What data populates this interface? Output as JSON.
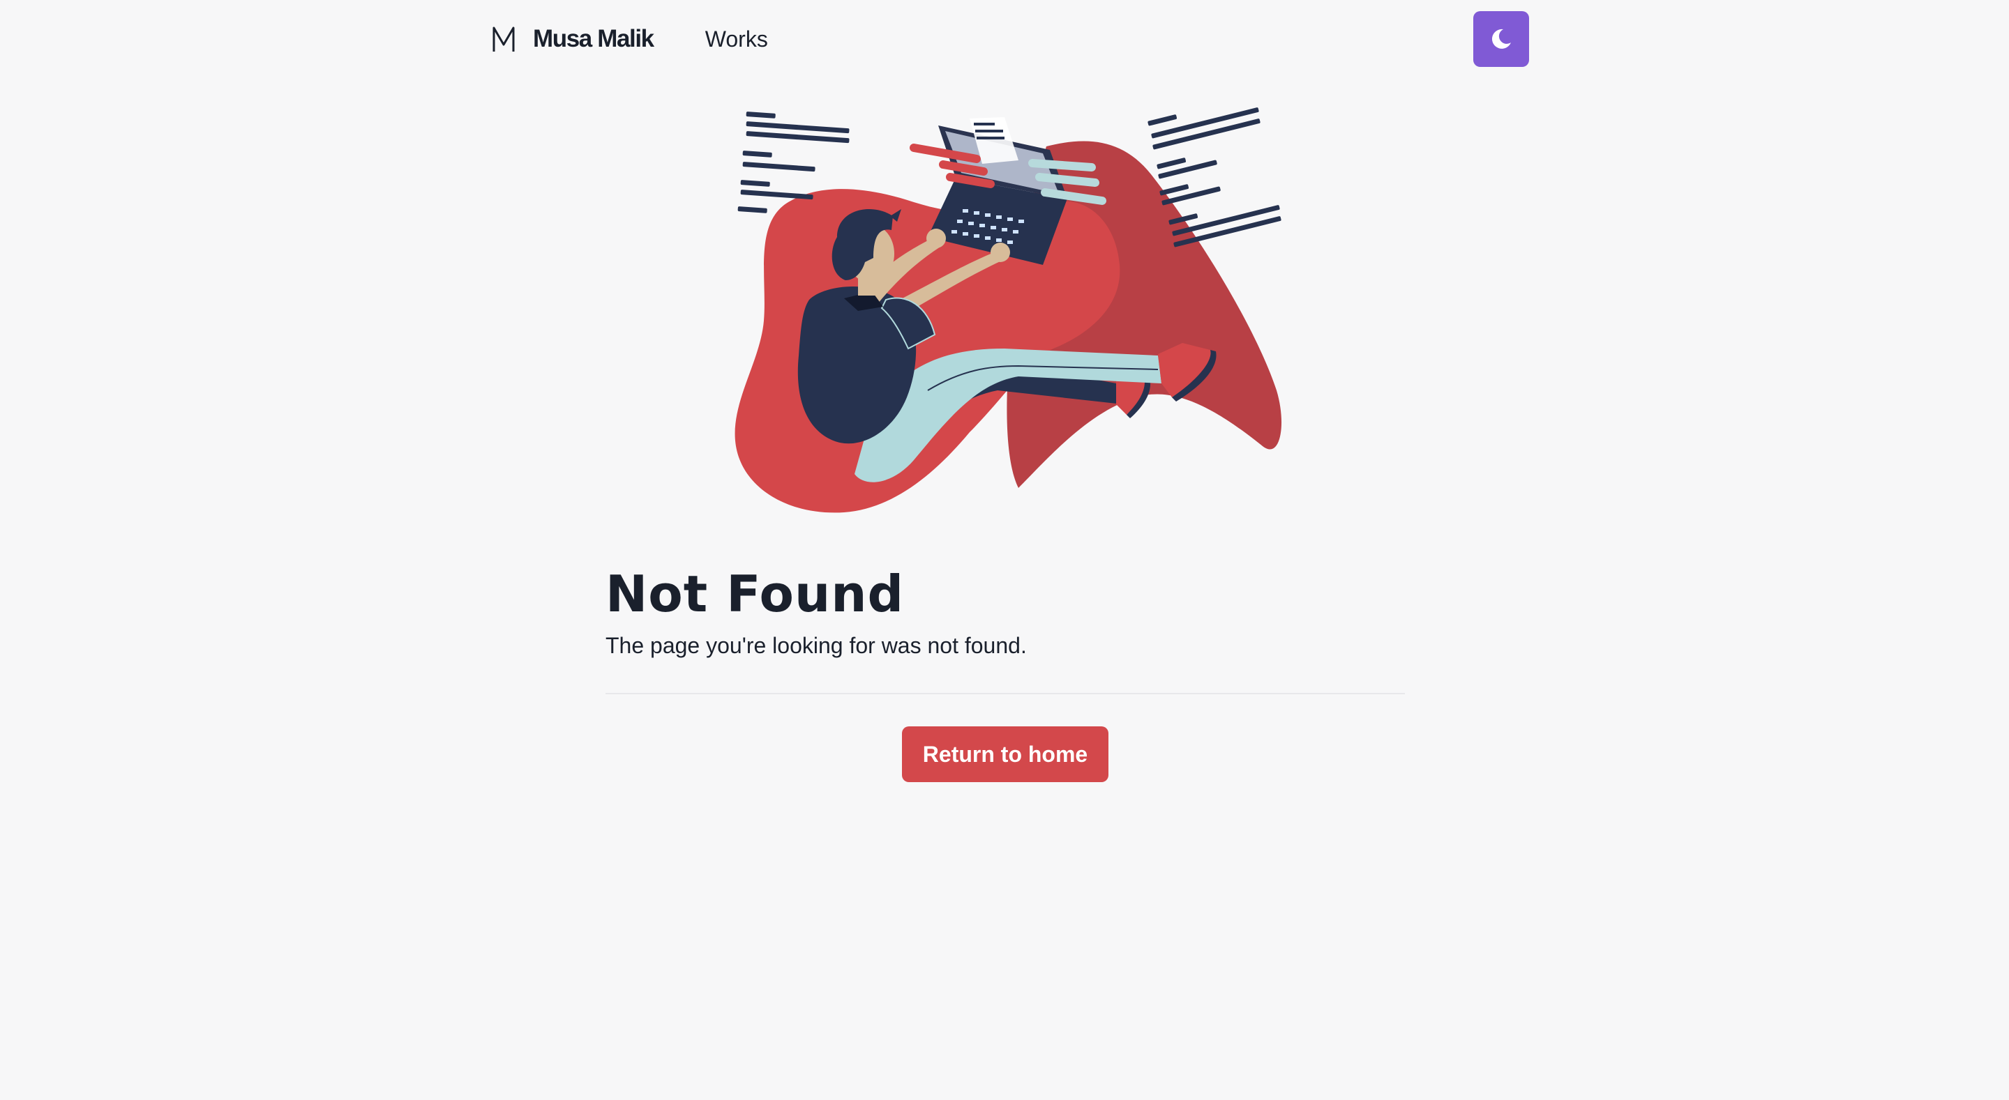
{
  "nav": {
    "brand_name": "Musa Malik",
    "links": [
      {
        "label": "Works"
      }
    ],
    "theme_toggle_icon": "moon-icon"
  },
  "main": {
    "title": "Not Found",
    "subtitle": "The page you're looking for was not found.",
    "cta_label": "Return to home"
  },
  "colors": {
    "accent_purple": "#805ad5",
    "cta_red": "#d3484b",
    "background": "#f7f7f8",
    "text": "#1a202c"
  }
}
